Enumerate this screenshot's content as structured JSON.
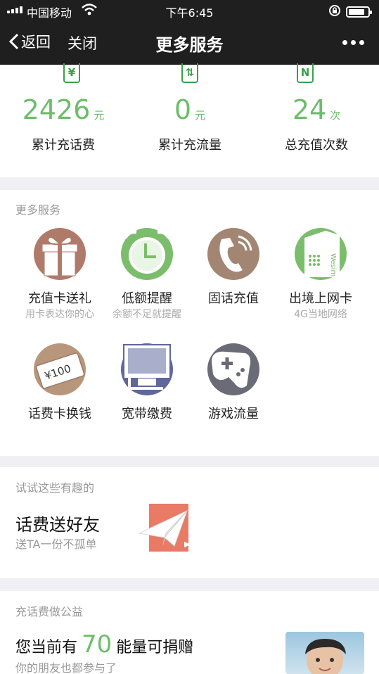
{
  "status_bar": {
    "carrier": "中国移动",
    "time": "下午6:45"
  },
  "nav": {
    "back_label": "返回",
    "close_label": "关闭",
    "title": "更多服务"
  },
  "stats": [
    {
      "value": "2426",
      "unit": "元",
      "label": "累计充话费",
      "icon_glyph": "¥"
    },
    {
      "value": "0",
      "unit": "元",
      "label": "累计充流量",
      "icon_glyph": "⇅"
    },
    {
      "value": "24",
      "unit": "次",
      "label": "总充值次数",
      "icon_glyph": "N"
    }
  ],
  "services": {
    "title": "更多服务",
    "items": [
      {
        "label": "充值卡送礼",
        "sub": "用卡表达你的心",
        "icon": "gift-icon"
      },
      {
        "label": "低额提醒",
        "sub": "余额不足就提醒",
        "icon": "alarm-clock-icon"
      },
      {
        "label": "固话充值",
        "sub": "",
        "icon": "telephone-icon"
      },
      {
        "label": "出境上网卡",
        "sub": "4G当地网络",
        "icon": "sim-card-icon",
        "icon_text": "Wesim"
      },
      {
        "label": "话费卡换钱",
        "sub": "",
        "icon": "voucher-card-icon",
        "icon_text": "¥100"
      },
      {
        "label": "宽带缴费",
        "sub": "",
        "icon": "monitor-icon"
      },
      {
        "label": "游戏流量",
        "sub": "",
        "icon": "gamepad-icon"
      }
    ]
  },
  "try": {
    "title": "试试这些有趣的",
    "headline": "话费送好友",
    "sub": "送TA一份不孤单",
    "icon": "paper-plane-icon"
  },
  "charity": {
    "title": "充话费做公益",
    "prefix": "您当前有",
    "value": "70",
    "suffix": "能量可捐赠",
    "sub": "你的朋友也都参与了"
  },
  "colors": {
    "accent_green": "#6dbd6a",
    "nav_bg": "#1f1f1f",
    "gift_brown": "#b07a6a",
    "clock_green": "#7cbd6c",
    "monitor_blue": "#5f679c",
    "plane_red": "#e87a66"
  }
}
